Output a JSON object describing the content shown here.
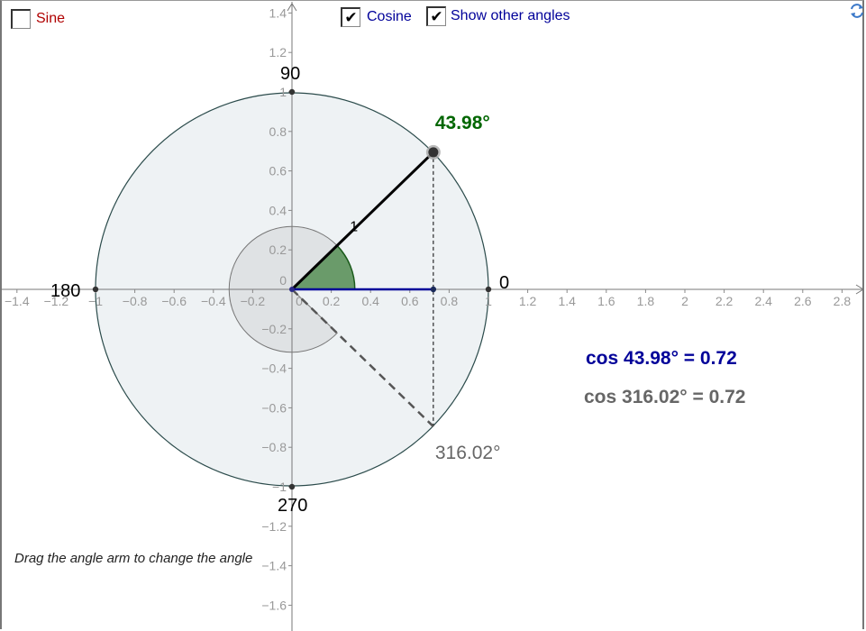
{
  "controls": {
    "sine": {
      "label": "Sine",
      "checked": false,
      "color": "#b00000"
    },
    "cosine": {
      "label": "Cosine",
      "checked": true,
      "color": "#000099"
    },
    "other_angles": {
      "label": "Show other angles",
      "checked": true,
      "color": "#000099"
    }
  },
  "refresh_icon": "refresh-icon",
  "graph": {
    "x_ticks": [
      "-1.4",
      "-1.2",
      "-1",
      "-0.8",
      "-0.6",
      "-0.4",
      "-0.2",
      "0",
      "0.2",
      "0.4",
      "0.6",
      "0.8",
      "1",
      "1.2",
      "1.4",
      "1.6",
      "1.8",
      "2",
      "2.2",
      "2.4",
      "2.6",
      "2.8"
    ],
    "y_ticks": [
      "1.4",
      "1.2",
      "1",
      "0.8",
      "0.6",
      "0.4",
      "0.2",
      "0",
      "-0.2",
      "-0.4",
      "-0.6",
      "-0.8",
      "-1",
      "-1.2",
      "-1.4",
      "-1.6"
    ],
    "degree_labels": {
      "d0": "0",
      "d90": "90",
      "d180": "180",
      "d270": "270"
    },
    "angle_deg": 43.98,
    "angle_label": "43.98°",
    "other_angle_label": "316.02°",
    "radius_label": "1",
    "colors": {
      "angle": "#006600",
      "cosine": "#000099",
      "other": "#666666"
    }
  },
  "readouts": {
    "cos_main": "cos 43.98° = 0.72",
    "cos_other": "cos 316.02° = 0.72"
  },
  "hint": "Drag the angle arm to change the angle"
}
